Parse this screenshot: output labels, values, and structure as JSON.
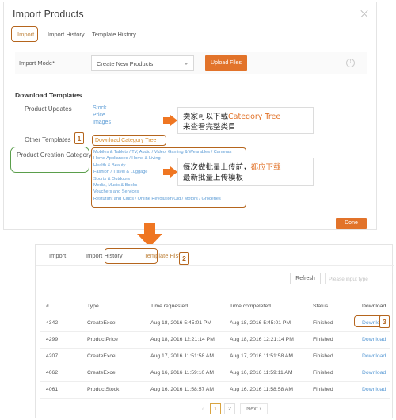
{
  "dialog": {
    "title": "Import Products",
    "close_icon": "close-icon",
    "tabs": [
      {
        "label": "Import",
        "active": true
      },
      {
        "label": "Import History",
        "active": false
      },
      {
        "label": "Template History",
        "active": false
      }
    ],
    "import_mode": {
      "label": "Import Mode*",
      "selected": "Create New Products",
      "caret_icon": "chevron-down-icon",
      "upload_label": "Upload Files",
      "help_icon": "help-circle-icon",
      "help_glyph": "!"
    },
    "download_templates": {
      "section_title": "Download Templates",
      "product_updates_label": "Product Updates",
      "product_updates_links": [
        "Stock",
        "Price",
        "Images"
      ],
      "other_templates_label": "Other Templates",
      "download_category_tree": "Download Category Tree",
      "product_creation_label": "Product Creation Category",
      "categories": [
        "Mobiles & Tablets / TV, Audio / Video, Gaming & Wearables / Cameras",
        "Home Appliances / Home & Living",
        "Health & Beauty",
        "Fashion / Travel & Luggage",
        "Sports & Outdoors",
        "Media, Music & Books",
        "Vouchers and Services",
        "Resturant and Clubs / Online Revolution Old / Motors / Groceries"
      ]
    },
    "done_label": "Done"
  },
  "annotations": {
    "marker_1": "1",
    "marker_2": "2",
    "marker_3": "3",
    "callout_1_line1_cn": "卖家可以下载",
    "callout_1_line1_en": "Category Tree",
    "callout_1_line2": "来查看完整类目",
    "callout_2_line1_a": "每次做批量上传前，",
    "callout_2_line1_b": "都应下载",
    "callout_2_line2": "最新批量上传模板",
    "highlight_color": "#b5651d",
    "green_color": "#5a9e4b",
    "arrow_color": "#ef7622"
  },
  "history": {
    "tabs": [
      {
        "label": "Import",
        "active": false
      },
      {
        "label": "Import History",
        "active": false
      },
      {
        "label": "Template History",
        "active": true
      }
    ],
    "refresh_label": "Refresh",
    "search_placeholder": "Please input type",
    "columns": [
      "#",
      "Type",
      "Time requested",
      "Time compeleted",
      "Status",
      "Download"
    ],
    "rows": [
      {
        "num": "4342",
        "type": "CreateExcel",
        "requested": "Aug 18, 2016 5:45:01 PM",
        "completed": "Aug 18, 2016 5:45:01 PM",
        "status": "Finished",
        "download": "Download"
      },
      {
        "num": "4299",
        "type": "ProductPrice",
        "requested": "Aug 18, 2016 12:21:14 PM",
        "completed": "Aug 18, 2016 12:21:14 PM",
        "status": "Finished",
        "download": "Download"
      },
      {
        "num": "4207",
        "type": "CreateExcel",
        "requested": "Aug 17, 2016 11:51:58 AM",
        "completed": "Aug 17, 2016 11:51:58 AM",
        "status": "Finished",
        "download": "Download"
      },
      {
        "num": "4062",
        "type": "CreateExcel",
        "requested": "Aug 16, 2016 11:59:10 AM",
        "completed": "Aug 16, 2016 11:59:11 AM",
        "status": "Finished",
        "download": "Download"
      },
      {
        "num": "4061",
        "type": "ProductStock",
        "requested": "Aug 16, 2016 11:58:57 AM",
        "completed": "Aug 16, 2016 11:58:58 AM",
        "status": "Finished",
        "download": "Download"
      }
    ],
    "pagination": {
      "prev_glyph": "‹",
      "pages": [
        "1",
        "2"
      ],
      "current": "1",
      "next_label": "Next ›"
    }
  }
}
